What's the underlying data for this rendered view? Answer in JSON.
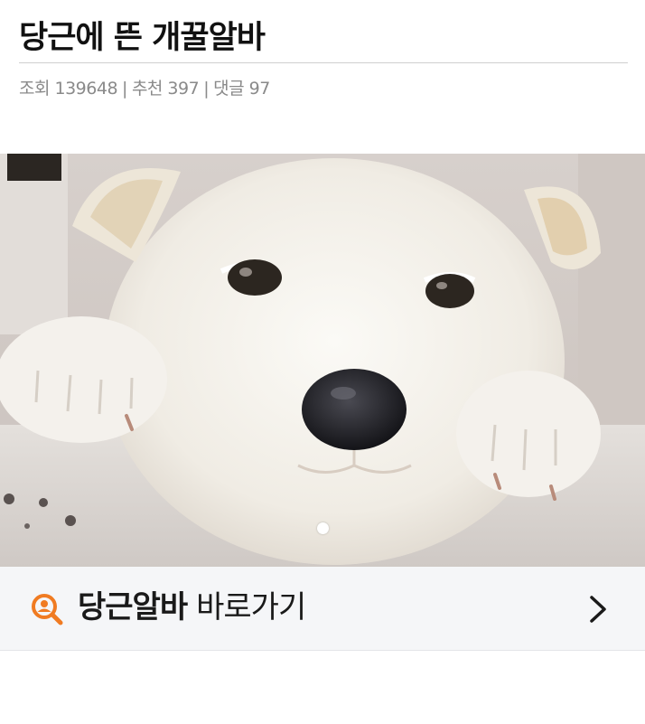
{
  "post": {
    "title": "당근에 뜬 개꿀알바",
    "views": "조회 139648",
    "recommend": "추천 397",
    "comments": "댓글 97",
    "separator": "|"
  },
  "carousel": {
    "image": "white puppy resting head on paws",
    "current_slide": 1,
    "total_slides": 1
  },
  "cta": {
    "brand": "당근알바",
    "action": "바로가기",
    "icon": "search-person-icon",
    "chevron": "chevron-right-icon",
    "accent": "#f07b22"
  }
}
